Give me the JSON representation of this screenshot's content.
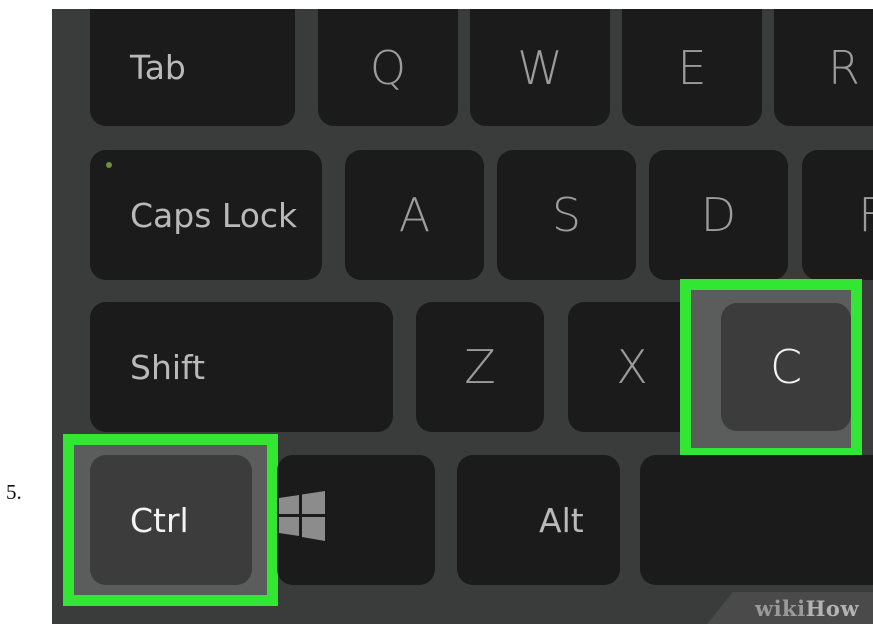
{
  "step_number": "5.",
  "keys": {
    "tab": "Tab",
    "q": "Q",
    "w": "W",
    "e": "E",
    "r": "R",
    "caps_lock": "Caps Lock",
    "a": "A",
    "s": "S",
    "d": "D",
    "f": "F",
    "shift": "Shift",
    "z": "Z",
    "x": "X",
    "c": "C",
    "ctrl": "Ctrl",
    "alt": "Alt"
  },
  "icons": {
    "windows_key": "windows-logo-icon"
  },
  "highlighted_keys": [
    "Ctrl",
    "C"
  ],
  "colors": {
    "highlight": "#33e633",
    "key_face": "#1b1b1b",
    "keyboard_base": "#3a3b3b",
    "caps_led": "#6f8f3c"
  },
  "watermark": {
    "prefix": "wiki",
    "brand": "How"
  }
}
